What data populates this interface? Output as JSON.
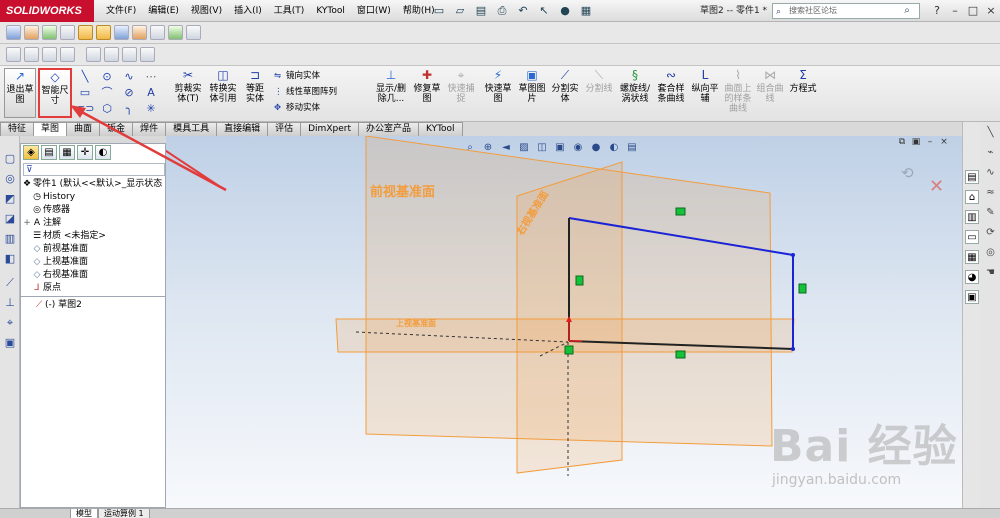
{
  "app": {
    "logo_text": "SOLIDWORKS",
    "document_title": "草图2 -- 零件1 *"
  },
  "menu": [
    "文件(F)",
    "编辑(E)",
    "视图(V)",
    "插入(I)",
    "工具(T)",
    "KYTool",
    "窗口(W)",
    "帮助(H)"
  ],
  "search": {
    "placeholder": "搜索社区论坛"
  },
  "command_manager": {
    "exit_sketch": "退出草图",
    "smart_dimension": "智能尺寸",
    "trim": "剪裁实体(T)",
    "convert": "转换实体引用",
    "offset": "等距实体",
    "mirror": "镜向实体",
    "linear_pattern": "线性草图阵列",
    "move": "移动实体",
    "display_delete": "显示/删除几...",
    "repair": "修复草图",
    "quick_snap": "快速捕捉",
    "rapid_sketch": "快速草图",
    "sketch_picture": "草图图片",
    "split_entity": "分割实体",
    "split_line": "分割线",
    "helix": "螺旋线/涡状线",
    "composite_curve": "套合样条曲线",
    "vertical_plane": "纵向平辅",
    "curve_on_surface": "曲面上的样条曲线",
    "combine_curve": "组合曲线",
    "equation": "方程式"
  },
  "tabs": [
    "特征",
    "草图",
    "曲面",
    "钣金",
    "焊件",
    "模具工具",
    "直接编辑",
    "评估",
    "DimXpert",
    "办公室产品",
    "KYTool"
  ],
  "active_tab": "草图",
  "feature_tree": {
    "root": "零件1 (默认<<默认>_显示状态",
    "items": [
      "History",
      "传感器",
      "注解",
      "材质 <未指定>",
      "前视基准面",
      "上视基准面",
      "右视基准面",
      "原点"
    ],
    "sketch": "(-) 草图2"
  },
  "graphics": {
    "plane_front": "前视基准面",
    "plane_right": "右视基准面",
    "plane_top": "上视基准面"
  },
  "bottom_tabs": [
    "模型",
    "运动算例 1"
  ],
  "watermark": {
    "main": "Bai 经验",
    "sub": "jingyan.baidu.com"
  },
  "colors": {
    "accent_red": "#e23b3b",
    "plane_orange": "#f39c3c",
    "sketch_blue": "#1a24d6",
    "relation_green": "#15c03a"
  }
}
